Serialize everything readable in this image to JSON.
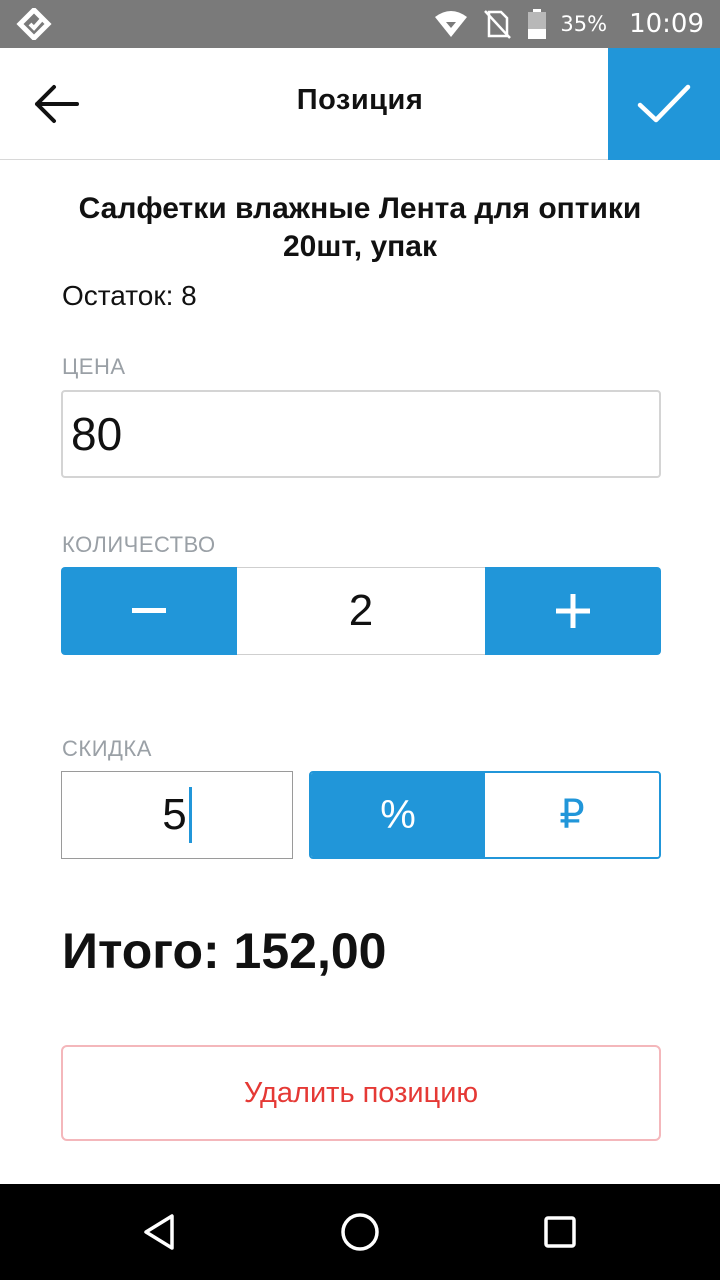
{
  "status_bar": {
    "battery": "35%",
    "time": "10:09",
    "icons": [
      "app-logo-icon",
      "wifi-icon",
      "no-sim-icon",
      "battery-icon"
    ]
  },
  "header": {
    "title": "Позиция",
    "back_icon": "arrow-left-icon",
    "confirm_icon": "check-icon"
  },
  "product": {
    "name": "Салфетки влажные Лента для оптики 20шт, упак",
    "stock_label": "Остаток: 8"
  },
  "price": {
    "label": "ЦЕНА",
    "value": "80"
  },
  "quantity": {
    "label": "КОЛИЧЕСТВО",
    "value": "2",
    "minus_icon": "minus-icon",
    "plus_icon": "plus-icon"
  },
  "discount": {
    "label": "СКИДКА",
    "value": "5",
    "options": [
      {
        "label": "%",
        "selected": true
      },
      {
        "label": "₽",
        "selected": false
      }
    ]
  },
  "total": {
    "text": "Итого: 152,00"
  },
  "actions": {
    "delete_label": "Удалить позицию"
  },
  "nav_bar": {
    "icons": [
      "back-triangle-icon",
      "home-circle-icon",
      "recents-square-icon"
    ]
  },
  "colors": {
    "accent": "#2196d9",
    "status_bar": "#7a7a7a",
    "danger": "#e53935",
    "danger_border": "#f4b7bb",
    "label_gray": "#9aa0a6"
  }
}
